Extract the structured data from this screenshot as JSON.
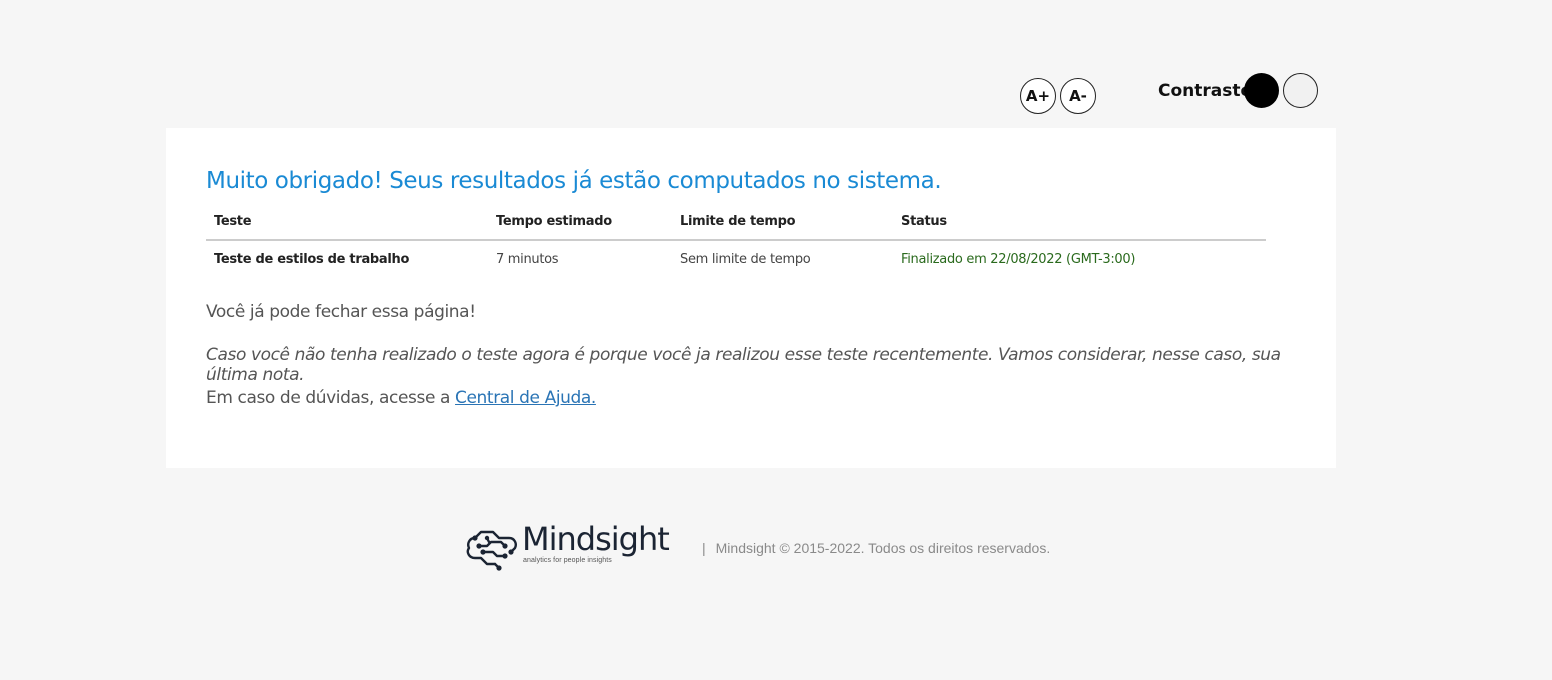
{
  "accessibility": {
    "increase_font_label": "A+",
    "decrease_font_label": "A-",
    "contrast_label": "Contraste"
  },
  "result": {
    "heading": "Muito obrigado! Seus resultados já estão computados no sistema.",
    "columns": [
      "Teste",
      "Tempo estimado",
      "Limite de tempo",
      "Status"
    ],
    "rows": [
      {
        "test": "Teste de estilos de trabalho",
        "estimated_time": "7 minutos",
        "time_limit": "Sem limite de tempo",
        "status": "Finalizado em 22/08/2022 (GMT-3:00)"
      }
    ],
    "close_message": "Você já pode fechar essa página!",
    "recent_note": "Caso você não tenha realizado o teste agora é porque você ja realizou esse teste recentemente. Vamos considerar, nesse caso, sua última nota.",
    "help_prefix": "Em caso de dúvidas, acesse a ",
    "help_link": "Central de Ajuda."
  },
  "footer": {
    "logo_name": "Mindsight",
    "logo_tagline": "analytics for people insights",
    "separator": "|",
    "copyright": "Mindsight © 2015-2022. Todos os direitos reservados."
  },
  "colors": {
    "heading": "#1a8ad4",
    "status": "#2a6a1d",
    "link": "#2a74b5",
    "background": "#f6f6f6"
  }
}
